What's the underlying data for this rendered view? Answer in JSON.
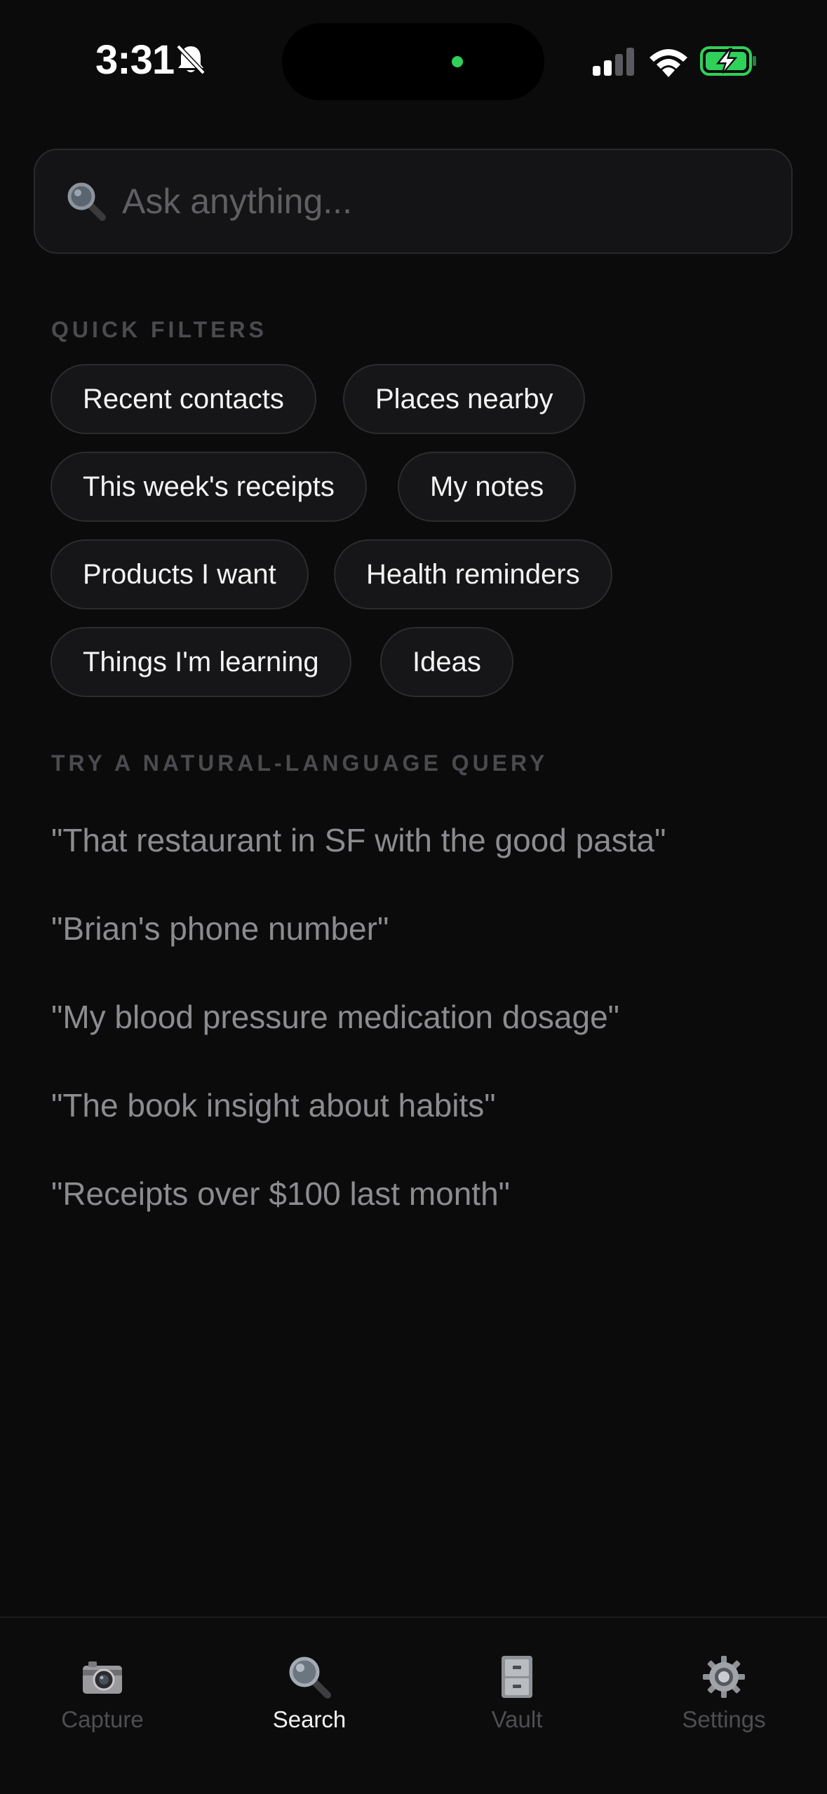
{
  "status_bar": {
    "time": "3:31",
    "icons": [
      "bell-slash-icon",
      "cellular-signal-icon",
      "wifi-icon",
      "battery-charging-icon"
    ],
    "battery_color": "#30d158"
  },
  "search": {
    "placeholder": "Ask anything...",
    "value": "",
    "icon": "magnifying-glass-icon"
  },
  "quick_filters": {
    "heading": "QUICK FILTERS",
    "chips": [
      "Recent contacts",
      "Places nearby",
      "This week's receipts",
      "My notes",
      "Products I want",
      "Health reminders",
      "Things I'm learning",
      "Ideas"
    ]
  },
  "queries": {
    "heading": "TRY A NATURAL-LANGUAGE QUERY",
    "items": [
      "\"That restaurant in SF with the good pasta\"",
      "\"Brian's phone number\"",
      "\"My blood pressure medication dosage\"",
      "\"The book insight about habits\"",
      "\"Receipts over $100 last month\""
    ]
  },
  "tab_bar": {
    "active": "Search",
    "tabs": [
      {
        "label": "Capture",
        "icon": "camera-icon"
      },
      {
        "label": "Search",
        "icon": "magnifying-glass-icon"
      },
      {
        "label": "Vault",
        "icon": "file-cabinet-icon"
      },
      {
        "label": "Settings",
        "icon": "gear-icon"
      }
    ]
  }
}
